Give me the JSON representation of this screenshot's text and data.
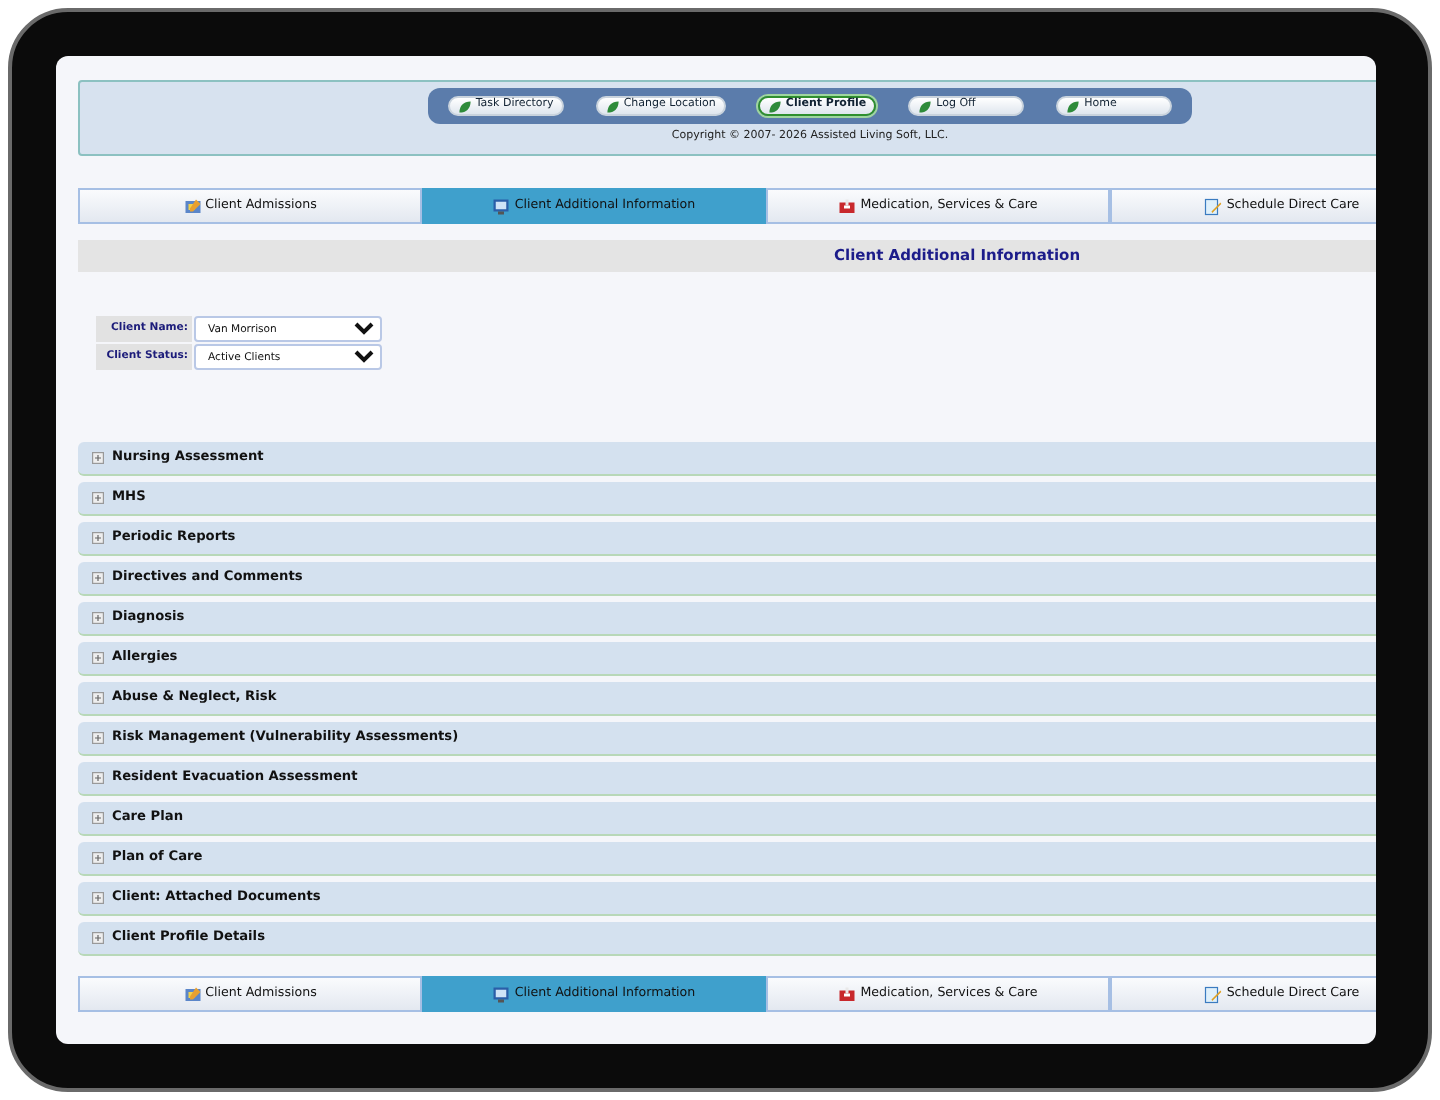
{
  "nav_buttons": [
    {
      "label": "Task Directory",
      "selected": false
    },
    {
      "label": "Change Location",
      "selected": false
    },
    {
      "label": "Client Profile",
      "selected": true
    },
    {
      "label": "Log Off",
      "selected": false
    },
    {
      "label": "Home",
      "selected": false
    }
  ],
  "copyright": "Copyright © 2007- 2026 Assisted Living Soft, LLC.",
  "tabs_top": [
    {
      "label": "Client Admissions",
      "selected": false
    },
    {
      "label": "Client Additional Information",
      "selected": true
    },
    {
      "label": "Medication, Services & Care",
      "selected": false
    },
    {
      "label": "Schedule Direct Care",
      "selected": false
    }
  ],
  "page_title": "Client Additional Information",
  "form": [
    {
      "label": "Client Name:",
      "value": "Van Morrison"
    },
    {
      "label": "Client Status:",
      "value": "Active Clients"
    }
  ],
  "sections": [
    {
      "title": "Nursing Assessment",
      "expanded": false
    },
    {
      "title": "MHS",
      "expanded": false
    },
    {
      "title": "Periodic Reports",
      "expanded": false
    },
    {
      "title": "Directives and Comments",
      "expanded": false
    },
    {
      "title": "Diagnosis",
      "expanded": false
    },
    {
      "title": "Allergies",
      "expanded": false
    },
    {
      "title": "Abuse & Neglect, Risk",
      "expanded": false
    },
    {
      "title": "Risk Management (Vulnerability Assessments)",
      "expanded": false
    },
    {
      "title": "Resident Evacuation Assessment",
      "expanded": false
    },
    {
      "title": "Care Plan",
      "expanded": false
    },
    {
      "title": "Plan of Care",
      "expanded": false
    },
    {
      "title": "Client: Attached Documents",
      "expanded": false
    },
    {
      "title": "Client Profile Details",
      "expanded": false
    }
  ],
  "tabs_bottom": [
    {
      "label": "Client Admissions",
      "selected": false
    },
    {
      "label": "Client Additional Information",
      "selected": true
    },
    {
      "label": "Medication, Services & Care",
      "selected": false
    },
    {
      "label": "Schedule Direct Care",
      "selected": false
    }
  ]
}
